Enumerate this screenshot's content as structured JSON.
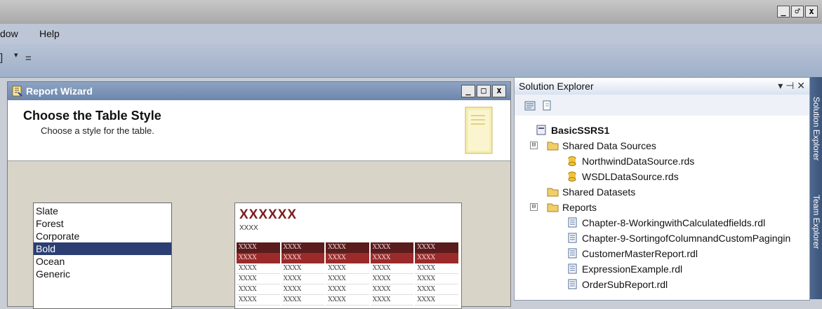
{
  "window_controls": [
    "_",
    "♂",
    "x"
  ],
  "menu": {
    "items": [
      "dow",
      "Help"
    ]
  },
  "toolbar": {
    "items": [
      "]",
      "▾",
      "="
    ]
  },
  "wizard": {
    "title": "Report Wizard",
    "controls": [
      "_",
      "□",
      "x"
    ],
    "heading": "Choose the Table Style",
    "subheading": "Choose a style for the table.",
    "styles": [
      "Slate",
      "Forest",
      "Corporate",
      "Bold",
      "Ocean",
      "Generic"
    ],
    "selected_style": "Bold",
    "preview": {
      "title": "XXXXXX",
      "subtitle": "XXXX",
      "rows": [
        [
          "XXXX",
          "XXXX",
          "XXXX",
          "XXXX",
          "XXXX"
        ],
        [
          "XXXX",
          "XXXX",
          "XXXX",
          "XXXX",
          "XXXX"
        ],
        [
          "XXXX",
          "XXXX",
          "XXXX",
          "XXXX",
          "XXXX"
        ],
        [
          "XXXX",
          "XXXX",
          "XXXX",
          "XXXX",
          "XXXX"
        ],
        [
          "XXXX",
          "XXXX",
          "XXXX",
          "XXXX",
          "XXXX"
        ],
        [
          "XXXX",
          "XXXX",
          "XXXX",
          "XXXX",
          "XXXX"
        ]
      ]
    }
  },
  "solution_explorer": {
    "title": "Solution Explorer",
    "title_buttons": "▾ ⊣ ✕",
    "project": "BasicSSRS1",
    "tree": [
      {
        "label": "Shared Data Sources",
        "expander": "⊟"
      },
      {
        "label": "NorthwindDataSource.rds"
      },
      {
        "label": "WSDLDataSource.rds"
      },
      {
        "label": "Shared Datasets"
      },
      {
        "label": "Reports",
        "expander": "⊟"
      },
      {
        "label": "Chapter-8-WorkingwithCalculatedfields.rdl"
      },
      {
        "label": "Chapter-9-SortingofColumnandCustomPagingin"
      },
      {
        "label": "CustomerMasterReport.rdl"
      },
      {
        "label": "ExpressionExample.rdl"
      },
      {
        "label": "OrderSubReport.rdl"
      }
    ]
  },
  "side_tabs": [
    "Solution Explorer",
    "Team Explorer"
  ],
  "colors": {
    "wizard_title": "#6c86ad",
    "selection": "#2b3f73",
    "preview_accent": "#7a1e1e",
    "preview_header": "#5a1c1c",
    "preview_row": "#9b2b2b"
  }
}
